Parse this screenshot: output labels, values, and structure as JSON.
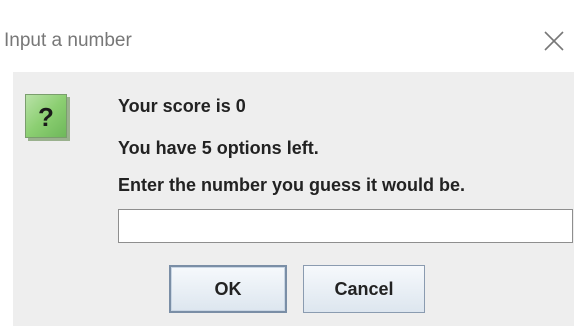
{
  "window": {
    "title": "Input a number"
  },
  "icons": {
    "close": "close-icon",
    "question": "question-mark-icon",
    "question_glyph": "?"
  },
  "message": {
    "line1": "Your score is 0",
    "line2": "You have 5 options left.",
    "line3": "Enter the number you guess it would be."
  },
  "input": {
    "value": "",
    "placeholder": ""
  },
  "buttons": {
    "ok_label": "OK",
    "cancel_label": "Cancel"
  },
  "colors": {
    "icon_green": "#8ccf72",
    "content_bg": "#eeeeee",
    "title_text": "#777777"
  }
}
